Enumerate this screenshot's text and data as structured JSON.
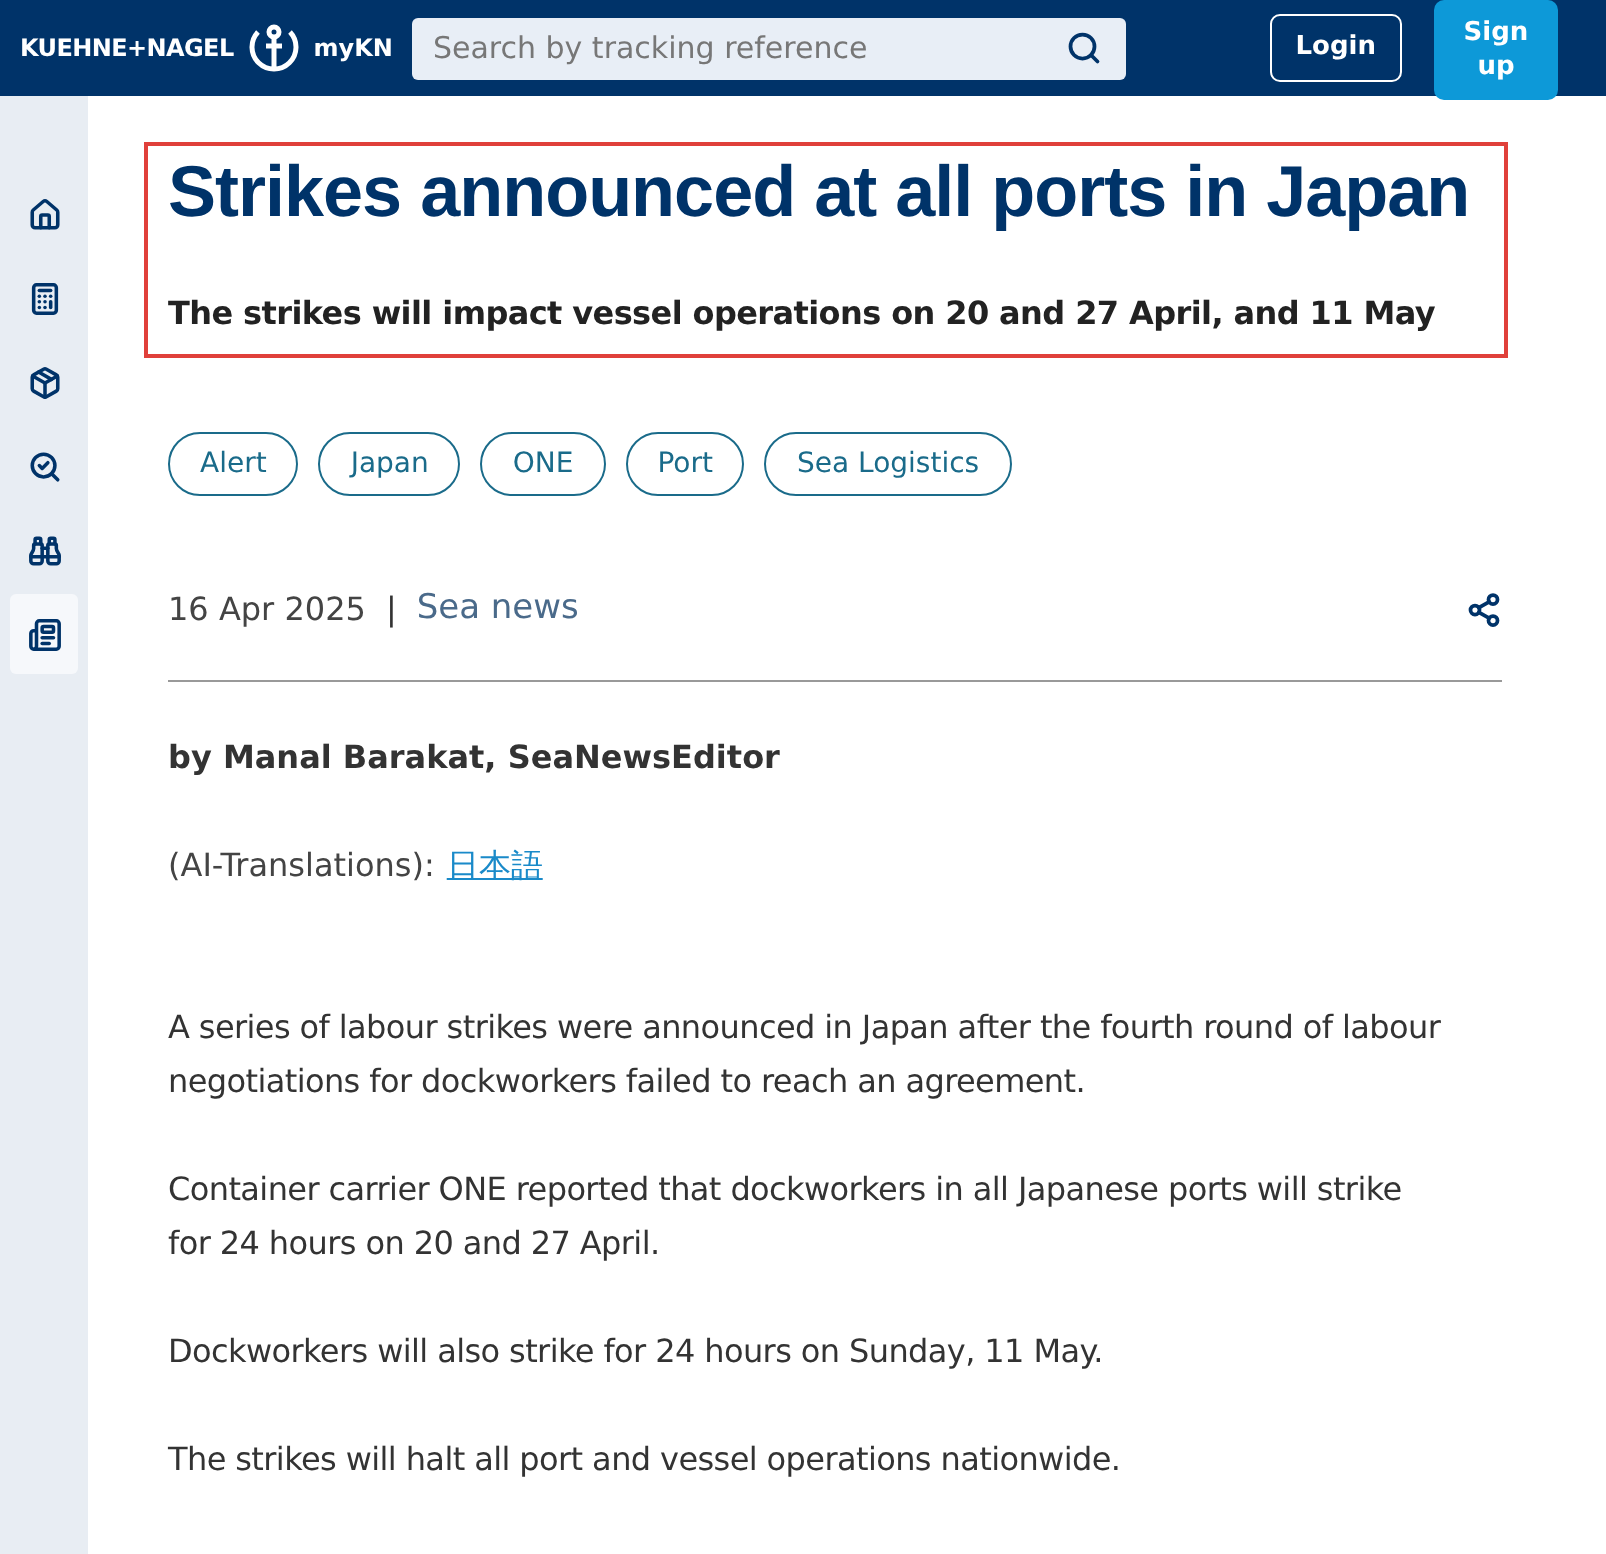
{
  "header": {
    "brand": "KUEHNE+NAGEL",
    "product": "myKN",
    "search": {
      "placeholder": "Search by tracking reference"
    },
    "login": "Login",
    "signup": "Sign up"
  },
  "sidebar": {
    "items": [
      {
        "kind": "home",
        "selected": false
      },
      {
        "kind": "calculator",
        "selected": false
      },
      {
        "kind": "box",
        "selected": false
      },
      {
        "kind": "track",
        "selected": false
      },
      {
        "kind": "binoculars",
        "selected": false
      },
      {
        "kind": "news",
        "selected": true
      }
    ]
  },
  "article": {
    "title": "Strikes announced at all ports in Japan",
    "subtitle": "The strikes will impact vessel operations on 20 and 27 April, and 11 May",
    "tags": [
      "Alert",
      "Japan",
      "ONE",
      "Port",
      "Sea Logistics"
    ],
    "date": "16 Apr 2025",
    "separator": "|",
    "category": "Sea news",
    "author": "by Manal Barakat, SeaNewsEditor",
    "translations_label": "(AI-Translations):",
    "translation_link": "日本語",
    "paragraphs": [
      "A series of labour strikes were announced in Japan after the fourth round of labour negotiations for dockworkers failed to reach an agreement.",
      "Container carrier ONE reported that dockworkers in all Japanese ports will strike for 24 hours on 20 and 27 April.",
      "Dockworkers will also strike for 24 hours on Sunday, 11 May.",
      "The strikes will halt all port and vessel operations nationwide."
    ]
  }
}
